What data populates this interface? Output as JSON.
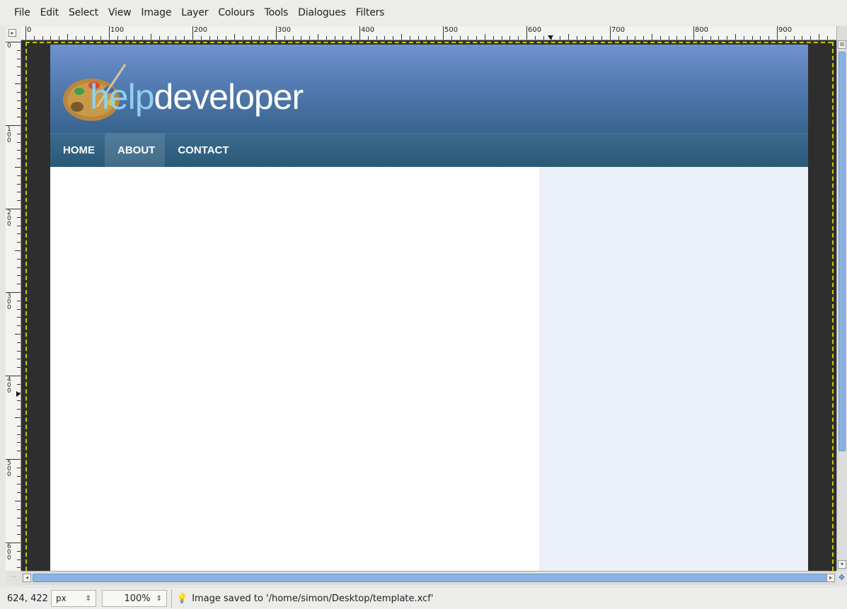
{
  "menubar": {
    "items": [
      {
        "label": "File",
        "u": "F"
      },
      {
        "label": "Edit",
        "u": "E"
      },
      {
        "label": "Select",
        "u": "S"
      },
      {
        "label": "View",
        "u": "V"
      },
      {
        "label": "Image",
        "u": "I"
      },
      {
        "label": "Layer",
        "u": "L"
      },
      {
        "label": "Colours",
        "u": "C"
      },
      {
        "label": "Tools",
        "u": "T"
      },
      {
        "label": "Dialogues",
        "u": "D"
      },
      {
        "label": "Filters",
        "u": "r"
      }
    ]
  },
  "rulers": {
    "horizontal_labels": [
      "0",
      "100",
      "200",
      "300",
      "400",
      "500",
      "600",
      "700",
      "800",
      "900"
    ],
    "vertical_labels": [
      "0",
      "100",
      "200",
      "300",
      "400",
      "500",
      "600"
    ]
  },
  "website": {
    "logo": {
      "part1": "help",
      "part2": "developer"
    },
    "nav": [
      "HOME",
      "ABOUT",
      "CONTACT"
    ],
    "active_nav": "ABOUT",
    "colors": {
      "header_top": "#6f93cf",
      "header_bottom": "#38648f",
      "nav": "#2a5977",
      "sidebar": "#ecf0f8",
      "logo_help": "#8fd0ef"
    }
  },
  "statusbar": {
    "coords": "624, 422",
    "unit": "px",
    "zoom": "100%",
    "message": "Image saved to '/home/simon/Desktop/template.xcf'"
  },
  "icons": {
    "status_icon": "lightbulb-icon",
    "corner": "navigate-icon"
  }
}
